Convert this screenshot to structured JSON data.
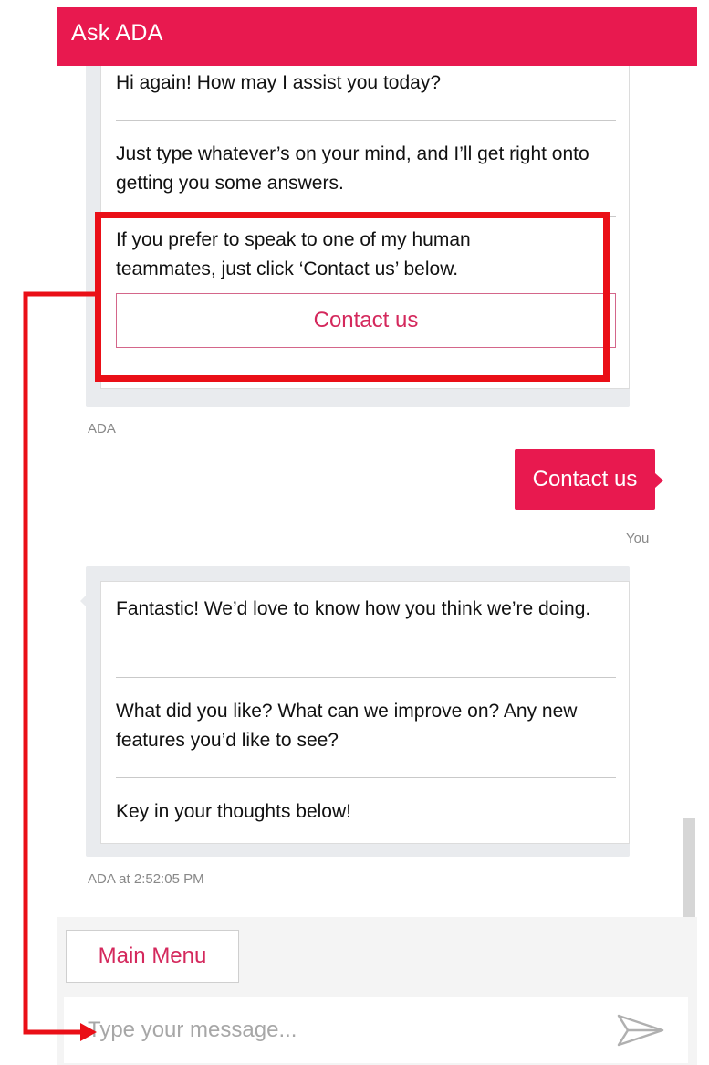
{
  "header": {
    "title": "Ask ADA"
  },
  "bot_group_1": {
    "messages": [
      "Hi again! How may I assist you today?",
      "Just type whatever’s on your mind, and I’ll get right onto getting you some answers.",
      "If you prefer to speak to one of my human teammates, just click ‘Contact us’ below."
    ],
    "option_label": "Contact us",
    "sender": "ADA"
  },
  "user_message": {
    "text": "Contact us",
    "sender": "You"
  },
  "bot_group_2": {
    "messages": [
      "Fantastic! We’d love to know how you think we’re doing.",
      "What did you like? What can we improve on? Any new features you’d like to see?",
      "Key in your thoughts below!"
    ],
    "meta": "ADA at 2:52:05 PM"
  },
  "quick_replies": {
    "main_menu_label": "Main Menu"
  },
  "composer": {
    "placeholder": "Type your message..."
  },
  "colors": {
    "brand": "#e8194f",
    "highlight": "#ea0f17",
    "link": "#d4285c"
  },
  "icons": {
    "send": "send-arrow-icon"
  }
}
